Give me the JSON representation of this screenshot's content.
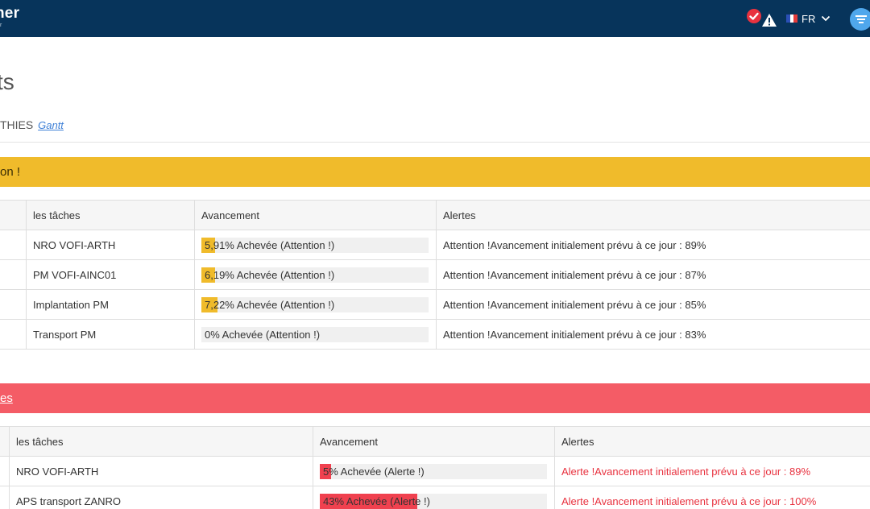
{
  "header": {
    "logo_text": "ner",
    "logo_sub": "r",
    "language": "FR",
    "icons": [
      "check-circle-icon",
      "warning-icon",
      "chevron-down-icon",
      "filter-menu-icon"
    ],
    "colors": {
      "topbar": "#07345b",
      "menu_button": "#4fa7ec",
      "check": "#e8323f"
    }
  },
  "page": {
    "title": "ts",
    "subtitle": "THIES",
    "gantt_link": "Gantt"
  },
  "attention_section": {
    "banner": "on !",
    "color": "#f0bb2b",
    "columns": [
      "les tâches",
      "Avancement",
      "Alertes"
    ],
    "rows": [
      {
        "task": "NRO VOFI-ARTH",
        "progress_pct": 5.91,
        "progress_label": "5,91% Achevée (Attention !)",
        "alert": "Attention !Avancement initialement prévu à ce jour : 89%"
      },
      {
        "task": "PM VOFI-AINC01",
        "progress_pct": 6.19,
        "progress_label": "6,19% Achevée (Attention !)",
        "alert": "Attention !Avancement initialement prévu à ce jour : 87%"
      },
      {
        "task": "Implantation PM",
        "progress_pct": 7.22,
        "progress_label": "7,22% Achevée (Attention !)",
        "alert": "Attention !Avancement initialement prévu à ce jour : 85%"
      },
      {
        "task": "Transport PM",
        "progress_pct": 0,
        "progress_label": "0% Achevée (Attention !)",
        "alert": "Attention !Avancement initialement prévu à ce jour : 83%"
      }
    ]
  },
  "alerte_section": {
    "banner": "es",
    "color": "#f45c66",
    "columns": [
      "les tâches",
      "Avancement",
      "Alertes"
    ],
    "rows": [
      {
        "task": "NRO VOFI-ARTH",
        "progress_pct": 5,
        "progress_label": "5% Achevée (Alerte !)",
        "alert": "Alerte !Avancement initialement prévu à ce jour : 89%"
      },
      {
        "task": "APS transport ZANRO",
        "progress_pct": 43,
        "progress_label": "43% Achevée (Alerte !)",
        "alert": "Alerte !Avancement initialement prévu à ce jour : 100%"
      }
    ]
  }
}
